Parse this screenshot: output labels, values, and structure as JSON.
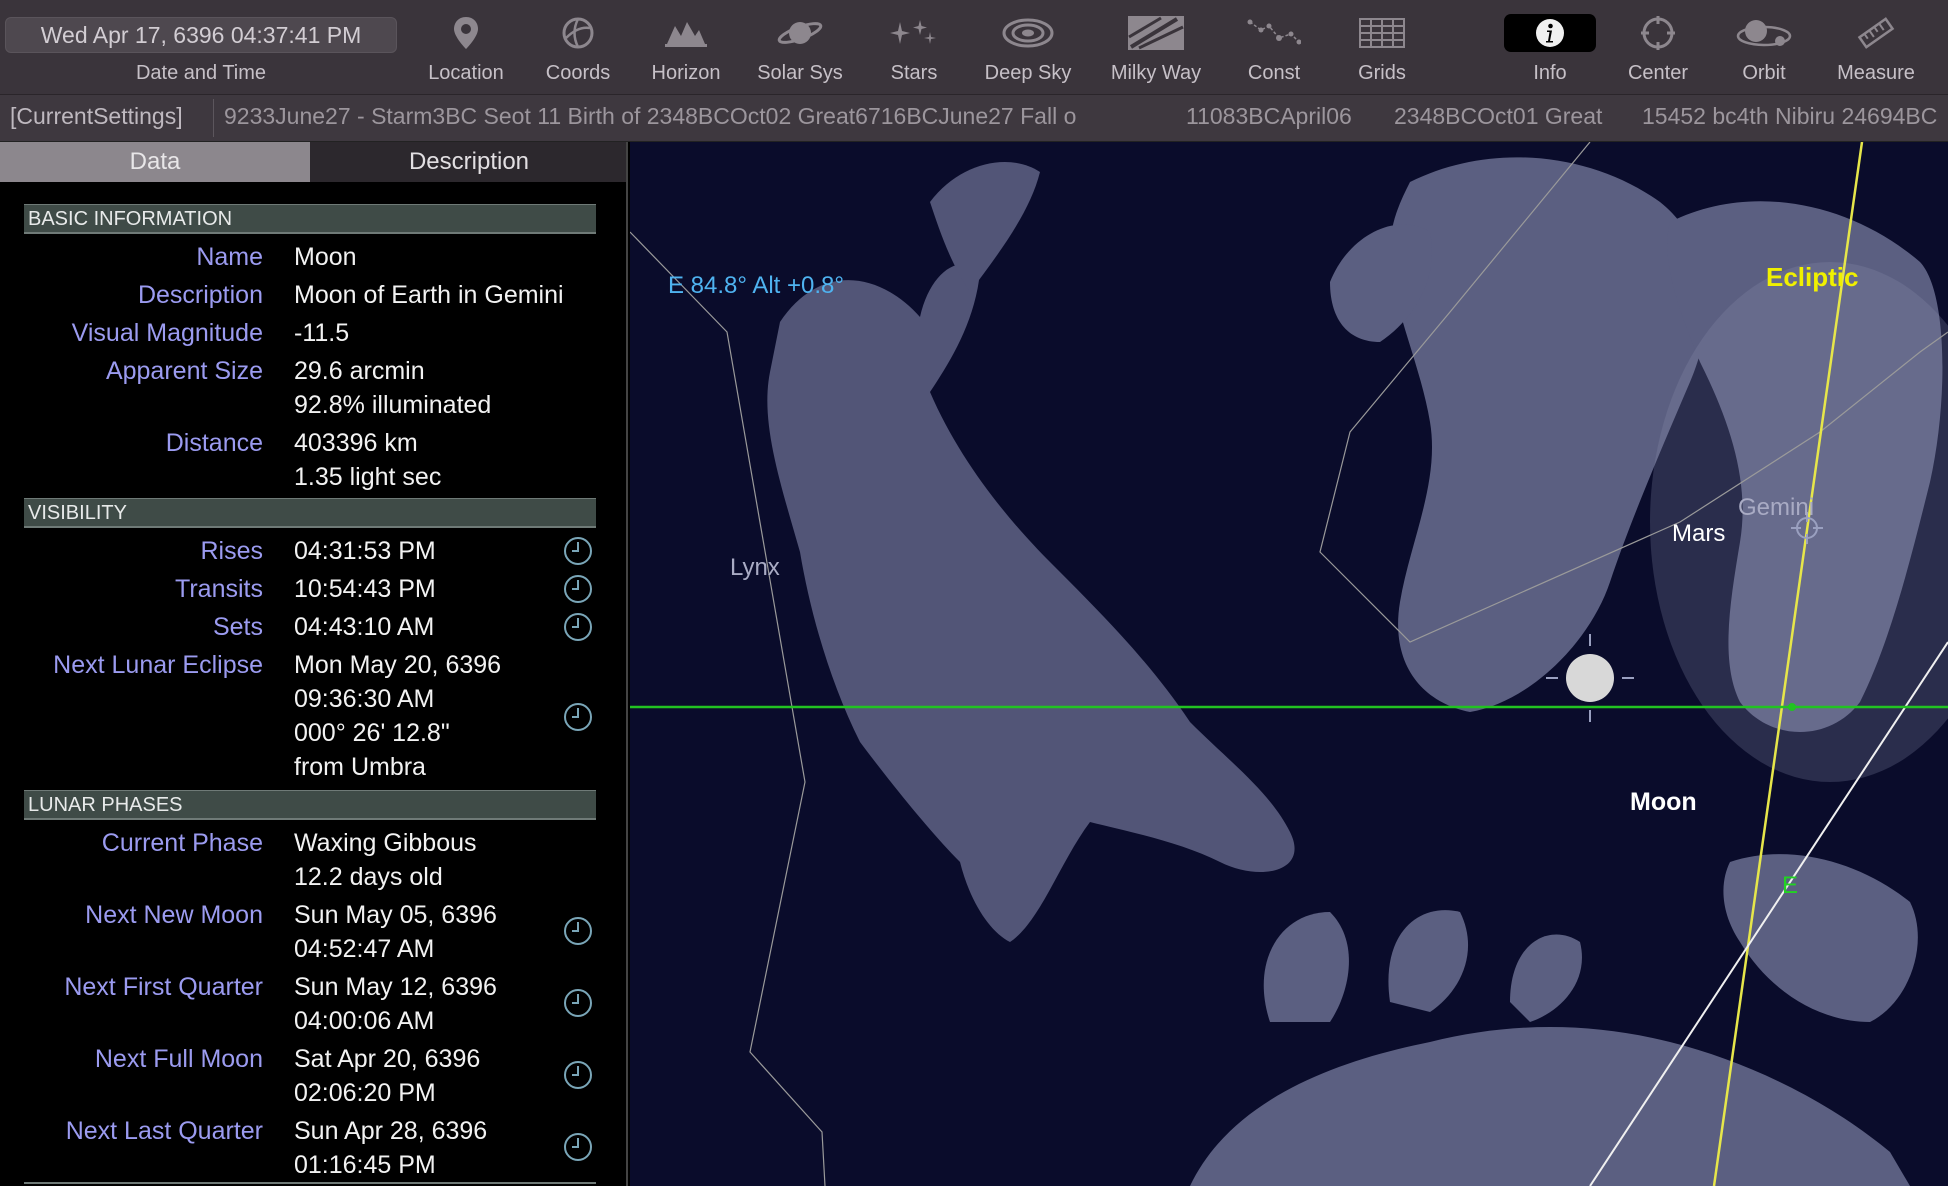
{
  "toolbar": {
    "datetime": "Wed Apr 17, 6396  04:37:41 PM",
    "datetime_label": "Date and Time",
    "tools": {
      "location": "Location",
      "coords": "Coords",
      "horizon": "Horizon",
      "solar_sys": "Solar Sys",
      "stars": "Stars",
      "deep_sky": "Deep Sky",
      "milky_way": "Milky Way",
      "const": "Const",
      "grids": "Grids",
      "info": "Info",
      "center": "Center",
      "orbit": "Orbit",
      "measure": "Measure"
    }
  },
  "settings_strip": {
    "current": "[CurrentSettings]",
    "tabs": [
      "9233June27 - Starm3BC Seot 11 Birth of 2348BCOct02 Great6716BCJune27 Fall o",
      "11083BCApril06",
      "2348BCOct01 Great",
      "15452 bc4th Nibiru 24694BC"
    ]
  },
  "panel": {
    "tabs": {
      "data": "Data",
      "description": "Description"
    },
    "basic": {
      "header": "BASIC INFORMATION",
      "name_label": "Name",
      "name": "Moon",
      "description_label": "Description",
      "description": "Moon of Earth in Gemini",
      "magnitude_label": "Visual Magnitude",
      "magnitude": "-11.5",
      "size_label": "Apparent Size",
      "size": "29.6 arcmin",
      "illumination": "92.8% illuminated",
      "distance_label": "Distance",
      "distance_km": "403396 km",
      "distance_ls": "1.35 light sec"
    },
    "visibility": {
      "header": "VISIBILITY",
      "rises_label": "Rises",
      "rises": "04:31:53 PM",
      "transits_label": "Transits",
      "transits": "10:54:43 PM",
      "sets_label": "Sets",
      "sets": "04:43:10 AM",
      "eclipse_label": "Next Lunar Eclipse",
      "eclipse_date": "Mon May 20, 6396",
      "eclipse_time": "09:36:30 AM",
      "eclipse_sep": "000° 26' 12.8\"",
      "eclipse_from": "from Umbra"
    },
    "phases": {
      "header": "LUNAR PHASES",
      "current_label": "Current Phase",
      "current": "Waxing Gibbous",
      "age": "12.2 days old",
      "new_label": "Next New Moon",
      "new_date": "Sun May 05, 6396",
      "new_time": "04:52:47 AM",
      "first_label": "Next First Quarter",
      "first_date": "Sun May 12, 6396",
      "first_time": "04:00:06 AM",
      "full_label": "Next Full Moon",
      "full_date": "Sat Apr 20, 6396",
      "full_time": "02:06:20 PM",
      "last_label": "Next Last Quarter",
      "last_date": "Sun Apr 28, 6396",
      "last_time": "01:16:45 PM"
    }
  },
  "sky": {
    "coords": "E 84.8° Alt +0.8°",
    "ecliptic": "Ecliptic",
    "gemini": "Gemini",
    "lynx": "Lynx",
    "mars": "Mars",
    "moon": "Moon",
    "east": "E",
    "colors": {
      "background": "#0a0c2b",
      "figure": "#5a5d80",
      "ecliptic": "#e6e64a",
      "horizon": "#22c322",
      "coords": "#4fb3f0"
    }
  }
}
